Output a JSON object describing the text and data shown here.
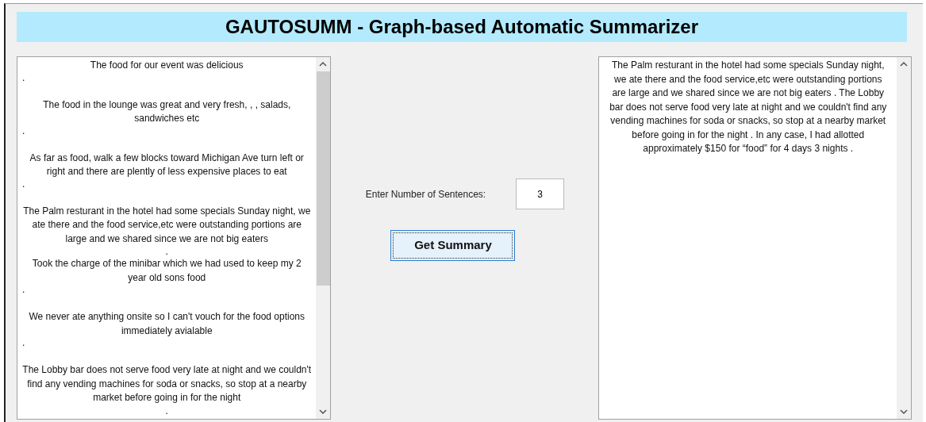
{
  "title": "GAUTOSUMM - Graph-based Automatic Summarizer",
  "input_text": [
    {
      "kind": "sentence",
      "text": "The food for our event was delicious"
    },
    {
      "kind": "dot",
      "text": "."
    },
    {
      "kind": "sentence",
      "text": "The food in the lounge was great and very fresh, , , salads, sandwiches etc"
    },
    {
      "kind": "dot",
      "text": "."
    },
    {
      "kind": "sentence",
      "text": "As far as food, walk a few blocks toward Michigan Ave turn left or right and there are plently of less expensive places to eat"
    },
    {
      "kind": "dot",
      "text": "."
    },
    {
      "kind": "sentence",
      "text": "The Palm resturant in the hotel had some specials Sunday night, we ate there and the food service,etc were outstanding portions are large and we shared since we are not big eaters"
    },
    {
      "kind": "middot",
      "text": "."
    },
    {
      "kind": "sentence",
      "text": "Took the charge of the minibar which we had used to keep my 2 year old sons food"
    },
    {
      "kind": "dot",
      "text": "."
    },
    {
      "kind": "sentence",
      "text": "We never ate anything onsite so I can't vouch for the food options immediately avialable"
    },
    {
      "kind": "dot",
      "text": "."
    },
    {
      "kind": "sentence",
      "text": "The Lobby bar does not serve food very late at night and we couldn't find any vending machines for soda or snacks, so stop at a nearby market before going in for the night"
    },
    {
      "kind": "middot",
      "text": "."
    }
  ],
  "sentences_label": "Enter Number of Sentences:",
  "sentences_value": "3",
  "summary_button": "Get Summary",
  "summary_text": "The Palm resturant in the hotel had some specials Sunday night, we ate there and the food service,etc were outstanding portions are large and we shared since we are not big eaters . The Lobby bar does not serve food very late at night and we couldn't find any vending machines for soda or snacks, so stop at a nearby market before going in for the night . In any case, I had allotted approximately $150 for “food” for 4 days 3 nights ."
}
